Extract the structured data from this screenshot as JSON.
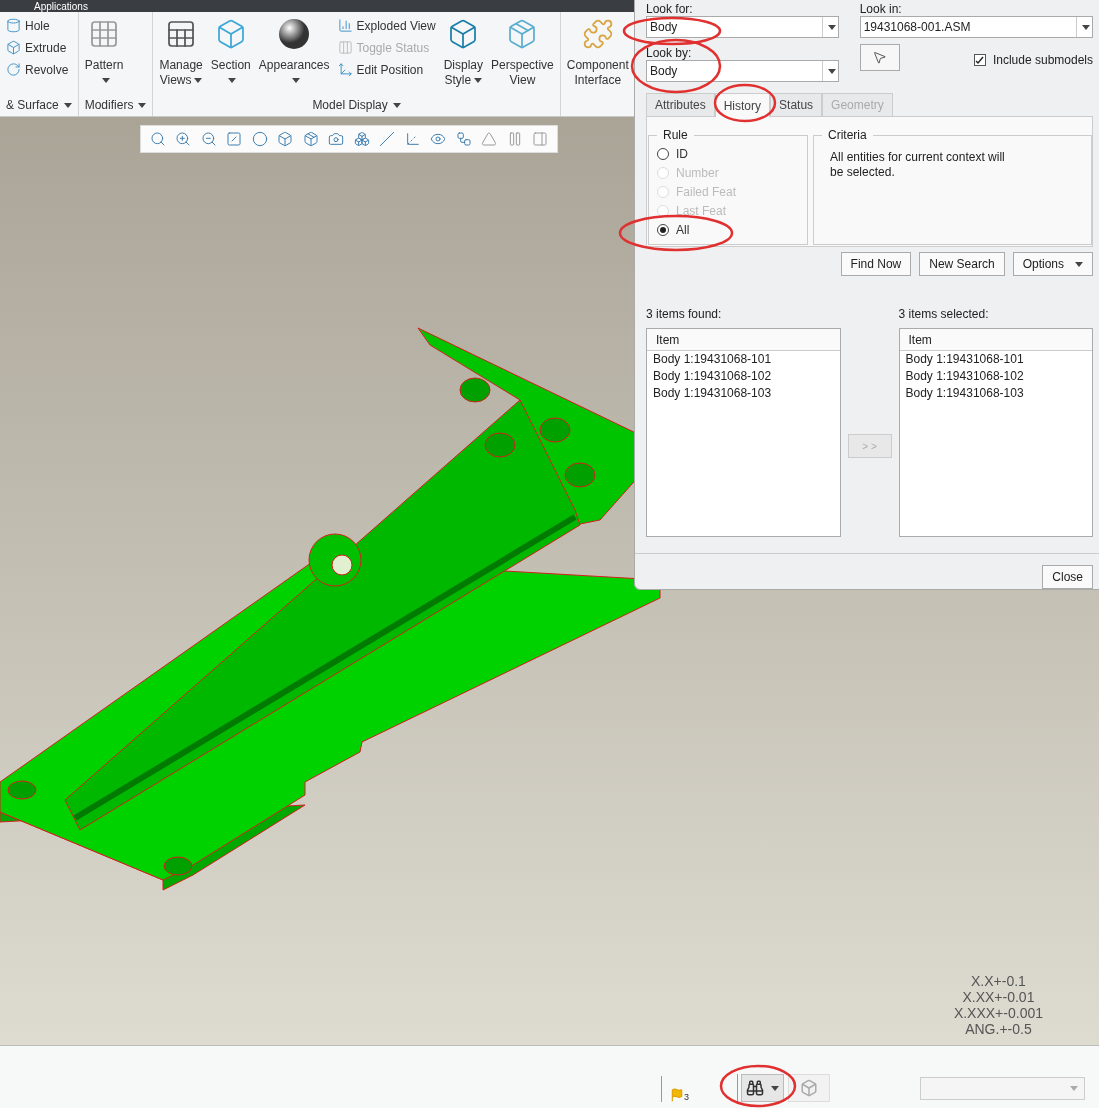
{
  "top_bar": {
    "title": "Applications"
  },
  "ribbon": {
    "groups": [
      {
        "label": "& Surface",
        "dropdown": true,
        "columns": [
          {
            "kind": "stack",
            "items": [
              {
                "label": "Hole",
                "disabled": false
              },
              {
                "label": "Extrude",
                "disabled": false
              },
              {
                "label": "Revolve",
                "disabled": false
              }
            ]
          }
        ]
      },
      {
        "label": "Modifiers",
        "dropdown": true,
        "columns": [
          {
            "kind": "large",
            "label": "Pattern",
            "dropdown": true
          }
        ]
      },
      {
        "label": "Model Display",
        "dropdown": true,
        "columns": [
          {
            "kind": "large",
            "label": "Manage Views",
            "dropdown": true
          },
          {
            "kind": "large",
            "label": "Section",
            "dropdown": true
          },
          {
            "kind": "large",
            "label": "Appearances",
            "dropdown": true
          },
          {
            "kind": "stack",
            "items": [
              {
                "label": "Exploded View",
                "disabled": false
              },
              {
                "label": "Toggle Status",
                "disabled": true
              },
              {
                "label": "Edit Position",
                "disabled": false
              }
            ]
          },
          {
            "kind": "large",
            "label": "Display Style",
            "dropdown": true
          },
          {
            "kind": "large",
            "label": "Perspective View",
            "dropdown": false
          }
        ]
      },
      {
        "columns": [
          {
            "kind": "large",
            "label": "Component Interface",
            "dropdown": false
          }
        ]
      }
    ]
  },
  "tolerances": [
    "X.X+-0.1",
    "X.XX+-0.01",
    "X.XXX+-0.001",
    "ANG.+-0.5"
  ],
  "dialog": {
    "look_for": {
      "label": "Look for:",
      "value": "Body"
    },
    "look_by": {
      "label": "Look by:",
      "value": "Body"
    },
    "look_in": {
      "label": "Look in:",
      "value": "19431068-001.ASM"
    },
    "include_submodels": {
      "label": "Include submodels",
      "checked": true
    },
    "tabs": [
      {
        "label": "Attributes",
        "selected": false,
        "disabled": false
      },
      {
        "label": "History",
        "selected": true,
        "disabled": false
      },
      {
        "label": "Status",
        "selected": false,
        "disabled": false
      },
      {
        "label": "Geometry",
        "selected": false,
        "disabled": true
      }
    ],
    "rule": {
      "title": "Rule",
      "options": [
        {
          "label": "ID",
          "selected": false,
          "disabled": false
        },
        {
          "label": "Number",
          "selected": false,
          "disabled": true
        },
        {
          "label": "Failed Feat",
          "selected": false,
          "disabled": true
        },
        {
          "label": "Last Feat",
          "selected": false,
          "disabled": true
        },
        {
          "label": "All",
          "selected": true,
          "disabled": false
        }
      ]
    },
    "criteria": {
      "title": "Criteria",
      "text": "All entities for current context will be selected."
    },
    "buttons": [
      {
        "label": "Find Now",
        "dropdown": false
      },
      {
        "label": "New Search",
        "dropdown": false
      },
      {
        "label": "Options",
        "dropdown": true
      }
    ],
    "found": {
      "label": "3 items found:",
      "column": "Item",
      "rows": [
        "Body 1:19431068-101",
        "Body 1:19431068-102",
        "Body 1:19431068-103"
      ]
    },
    "transfer_button": {
      "label": "> >",
      "disabled": true
    },
    "selected": {
      "label": "3 items selected:",
      "column": "Item",
      "rows": [
        "Body 1:19431068-101",
        "Body 1:19431068-102",
        "Body 1:19431068-103"
      ]
    },
    "close_button": "Close"
  },
  "status_bar": {
    "message_count": "3"
  }
}
